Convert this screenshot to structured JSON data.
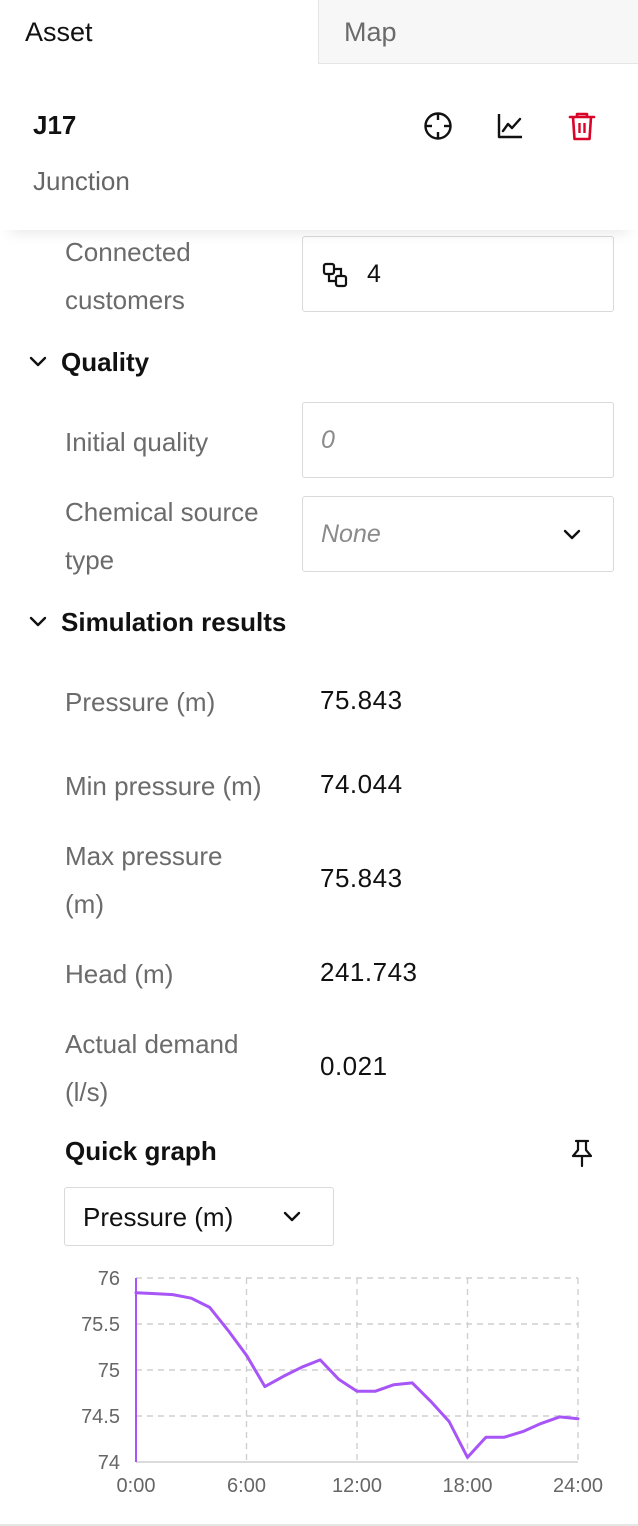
{
  "tabs": [
    {
      "label": "Asset"
    },
    {
      "label": "Map"
    }
  ],
  "asset": {
    "id": "J17",
    "type": "Junction",
    "actions": {
      "locate_icon": "crosshair-icon",
      "chart_icon": "line-chart-icon",
      "delete_icon": "trash-icon",
      "delete_color": "#d90429"
    }
  },
  "connected_customers": {
    "label_line1": "Connected",
    "label_line2": "customers",
    "icon": "customers-link-icon",
    "value": "4"
  },
  "quality": {
    "section_label": "Quality",
    "initial_quality": {
      "label": "Initial quality",
      "placeholder": "0"
    },
    "chemical_source": {
      "label_line1": "Chemical source",
      "label_line2": "type",
      "value": "None"
    }
  },
  "simulation": {
    "section_label": "Simulation results",
    "rows": [
      {
        "label_line1": "Pressure (m)",
        "label_line2": "",
        "value": "75.843"
      },
      {
        "label_line1": "Min pressure (m)",
        "label_line2": "",
        "value": "74.044"
      },
      {
        "label_line1": "Max pressure",
        "label_line2": "(m)",
        "value": "75.843"
      },
      {
        "label_line1": "Head (m)",
        "label_line2": "",
        "value": "241.743"
      },
      {
        "label_line1": "Actual demand",
        "label_line2": "(l/s)",
        "value": "0.021"
      }
    ]
  },
  "quick_graph": {
    "title": "Quick graph",
    "pin_icon": "pin-icon",
    "selected_metric": "Pressure (m)"
  },
  "chart_data": {
    "type": "line",
    "x_tick_labels": [
      "0:00",
      "6:00",
      "12:00",
      "18:00",
      "24:00"
    ],
    "y_tick_labels": [
      "76",
      "75.5",
      "75",
      "74.5",
      "74"
    ],
    "ylim": [
      74,
      76
    ],
    "xlim": [
      0,
      24
    ],
    "grid": true,
    "line_color": "#a855f7",
    "series": [
      {
        "x": [
          0,
          1,
          2,
          3,
          4,
          5,
          6,
          7,
          8,
          9,
          10,
          11,
          12,
          13,
          14,
          15,
          16,
          17,
          18,
          19,
          20,
          21,
          22,
          23,
          24
        ],
        "values": [
          75.84,
          75.83,
          75.82,
          75.78,
          75.68,
          75.43,
          75.16,
          74.82,
          74.93,
          75.03,
          75.11,
          74.9,
          74.77,
          74.77,
          74.84,
          74.86,
          74.66,
          74.44,
          74.05,
          74.27,
          74.27,
          74.33,
          74.42,
          74.49,
          74.47
        ]
      }
    ]
  }
}
